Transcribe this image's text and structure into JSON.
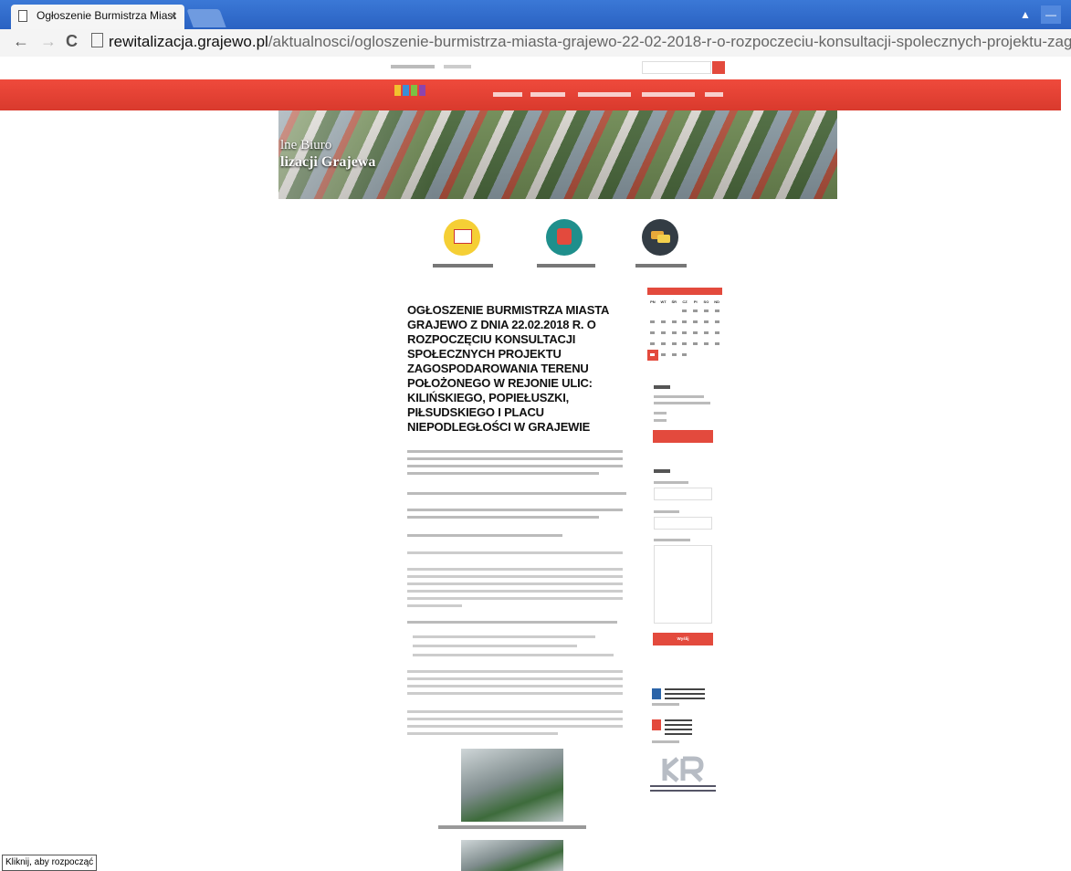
{
  "browser": {
    "tab_title": "Ogłoszenie Burmistrza Miast",
    "tab_close": "×",
    "url_host": "rewitalizacja.grajewo.pl",
    "url_path": "/aktualnosci/ogloszenie-burmistrza-miasta-grajewo-22-02-2018-r-o-rozpoczeciu-konsultacji-spolecznych-projektu-zagospodarowa",
    "back": "←",
    "forward": "→",
    "reload": "C",
    "win_user": "▲",
    "win_min": "—"
  },
  "banner": {
    "line1": "lne Biuro",
    "line2": "lizacji Grajewa"
  },
  "article": {
    "headline": "OGŁOSZENIE BURMISTRZA MIASTA GRAJEWO Z DNIA 22.02.2018 R. O ROZPOCZĘCIU KONSULTACJI SPOŁECZNYCH PROJEKTU ZAGOSPODAROWANIA TERENU POŁOŻONEGO W REJONIE ULIC: KILIŃSKIEGO, POPIEŁUSZKI, PIŁSUDSKIEGO I PLACU NIEPODLEGŁOŚCI W GRAJEWIE"
  },
  "sidebar": {
    "calendar_days": [
      "PN",
      "WT",
      "ŚR",
      "CZ",
      "PI",
      "SO",
      "ND"
    ],
    "submit_label": "Wyślij"
  },
  "colors": {
    "accent_red": "#e34a3d",
    "chrome_blue": "#2a62c2"
  },
  "status_text": "Kliknij, aby rozpocząć"
}
